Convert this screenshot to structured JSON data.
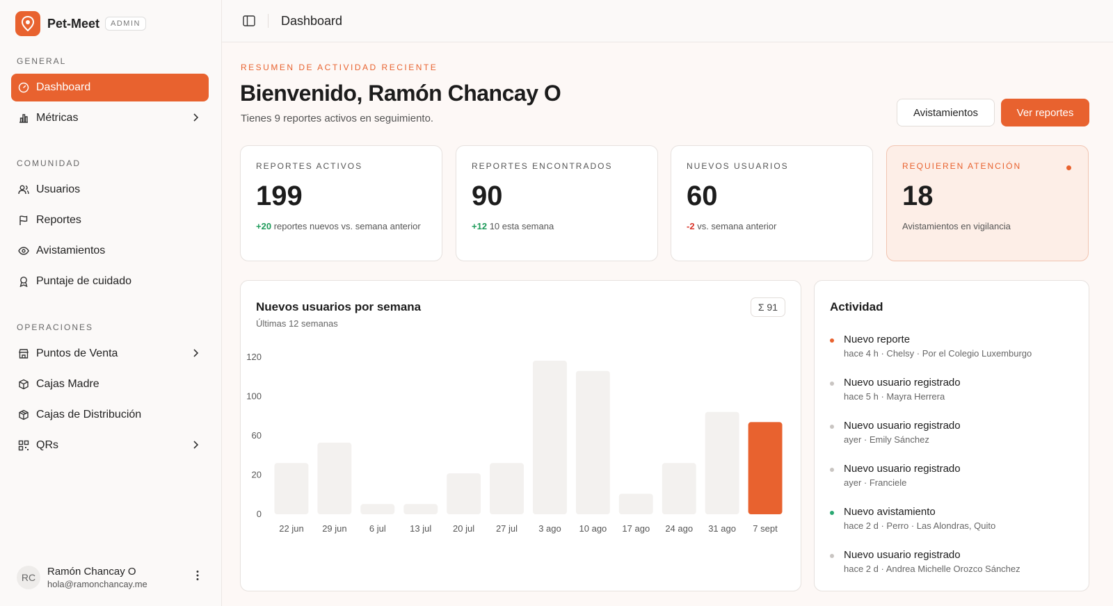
{
  "brand": {
    "name": "Pet-Meet",
    "badge": "ADMIN"
  },
  "sidebar": {
    "sections": [
      {
        "label": "GENERAL"
      },
      {
        "label": "COMUNIDAD"
      },
      {
        "label": "OPERACIONES"
      }
    ],
    "items": [
      {
        "label": "Dashboard",
        "icon": "gauge-icon",
        "active": true
      },
      {
        "label": "Métricas",
        "icon": "bar-chart-icon",
        "has_submenu": true
      },
      {
        "label": "Usuarios",
        "icon": "users-icon"
      },
      {
        "label": "Reportes",
        "icon": "flag-icon"
      },
      {
        "label": "Avistamientos",
        "icon": "eye-icon"
      },
      {
        "label": "Puntaje de cuidado",
        "icon": "award-icon"
      },
      {
        "label": "Puntos de Venta",
        "icon": "store-icon",
        "has_submenu": true
      },
      {
        "label": "Cajas Madre",
        "icon": "box-icon"
      },
      {
        "label": "Cajas de Distribución",
        "icon": "package-icon"
      },
      {
        "label": "QRs",
        "icon": "qr-icon",
        "has_submenu": true
      }
    ]
  },
  "user": {
    "initials": "RC",
    "name": "Ramón Chancay O",
    "email": "hola@ramonchancay.me"
  },
  "topbar": {
    "title": "Dashboard"
  },
  "header": {
    "kicker": "RESUMEN DE ACTIVIDAD RECIENTE",
    "welcome": "Bienvenido, Ramón Chancay O",
    "subtitle": "Tienes 9 reportes activos en seguimiento.",
    "btn_secondary": "Avistamientos",
    "btn_primary": "Ver reportes"
  },
  "stats": [
    {
      "label": "REPORTES ACTIVOS",
      "value": "199",
      "delta": "+20",
      "delta_type": "pos",
      "note": "reportes nuevos vs. semana anterior"
    },
    {
      "label": "REPORTES ENCONTRADOS",
      "value": "90",
      "delta": "+12",
      "delta_type": "pos",
      "note": "10 esta semana"
    },
    {
      "label": "NUEVOS USUARIOS",
      "value": "60",
      "delta": "-2",
      "delta_type": "neg",
      "note": "vs. semana anterior"
    },
    {
      "label": "REQUIEREN ATENCIÓN",
      "value": "18",
      "delta": "",
      "delta_type": "",
      "note": "Avistamientos en vigilancia"
    }
  ],
  "chart": {
    "title": "Nuevos usuarios por semana",
    "subtitle": "Últimas 12 semanas",
    "sum_badge": "Σ 91"
  },
  "chart_data": {
    "type": "bar",
    "categories": [
      "22 jun",
      "29 jun",
      "6 jul",
      "13 jul",
      "20 jul",
      "27 jul",
      "3 ago",
      "10 ago",
      "17 ago",
      "24 ago",
      "31 ago",
      "7 sept"
    ],
    "values": [
      50,
      70,
      10,
      10,
      40,
      50,
      150,
      140,
      20,
      50,
      100,
      90
    ],
    "yticks": [
      "0",
      "20",
      "60",
      "100",
      "120"
    ],
    "highlight_index": 11,
    "colors": {
      "bar": "#f3f1ef",
      "highlight": "#e8622f"
    },
    "title": "Nuevos usuarios por semana",
    "xlabel": "",
    "ylabel": ""
  },
  "activity": {
    "title": "Actividad",
    "items": [
      {
        "title": "Nuevo reporte",
        "meta": "hace 4 h · Chelsy · Por el Colegio Luxemburgo",
        "dot": "#e8622f"
      },
      {
        "title": "Nuevo usuario registrado",
        "meta": "hace 5 h · Mayra Herrera",
        "dot": "#c9c5c2"
      },
      {
        "title": "Nuevo usuario registrado",
        "meta": "ayer · Emily Sánchez",
        "dot": "#c9c5c2"
      },
      {
        "title": "Nuevo usuario registrado",
        "meta": "ayer · Franciele",
        "dot": "#c9c5c2"
      },
      {
        "title": "Nuevo avistamiento",
        "meta": "hace 2 d · Perro · Las Alondras, Quito",
        "dot": "#2aa872"
      },
      {
        "title": "Nuevo usuario registrado",
        "meta": "hace 2 d · Andrea Michelle Orozco Sánchez",
        "dot": "#c9c5c2"
      }
    ]
  }
}
